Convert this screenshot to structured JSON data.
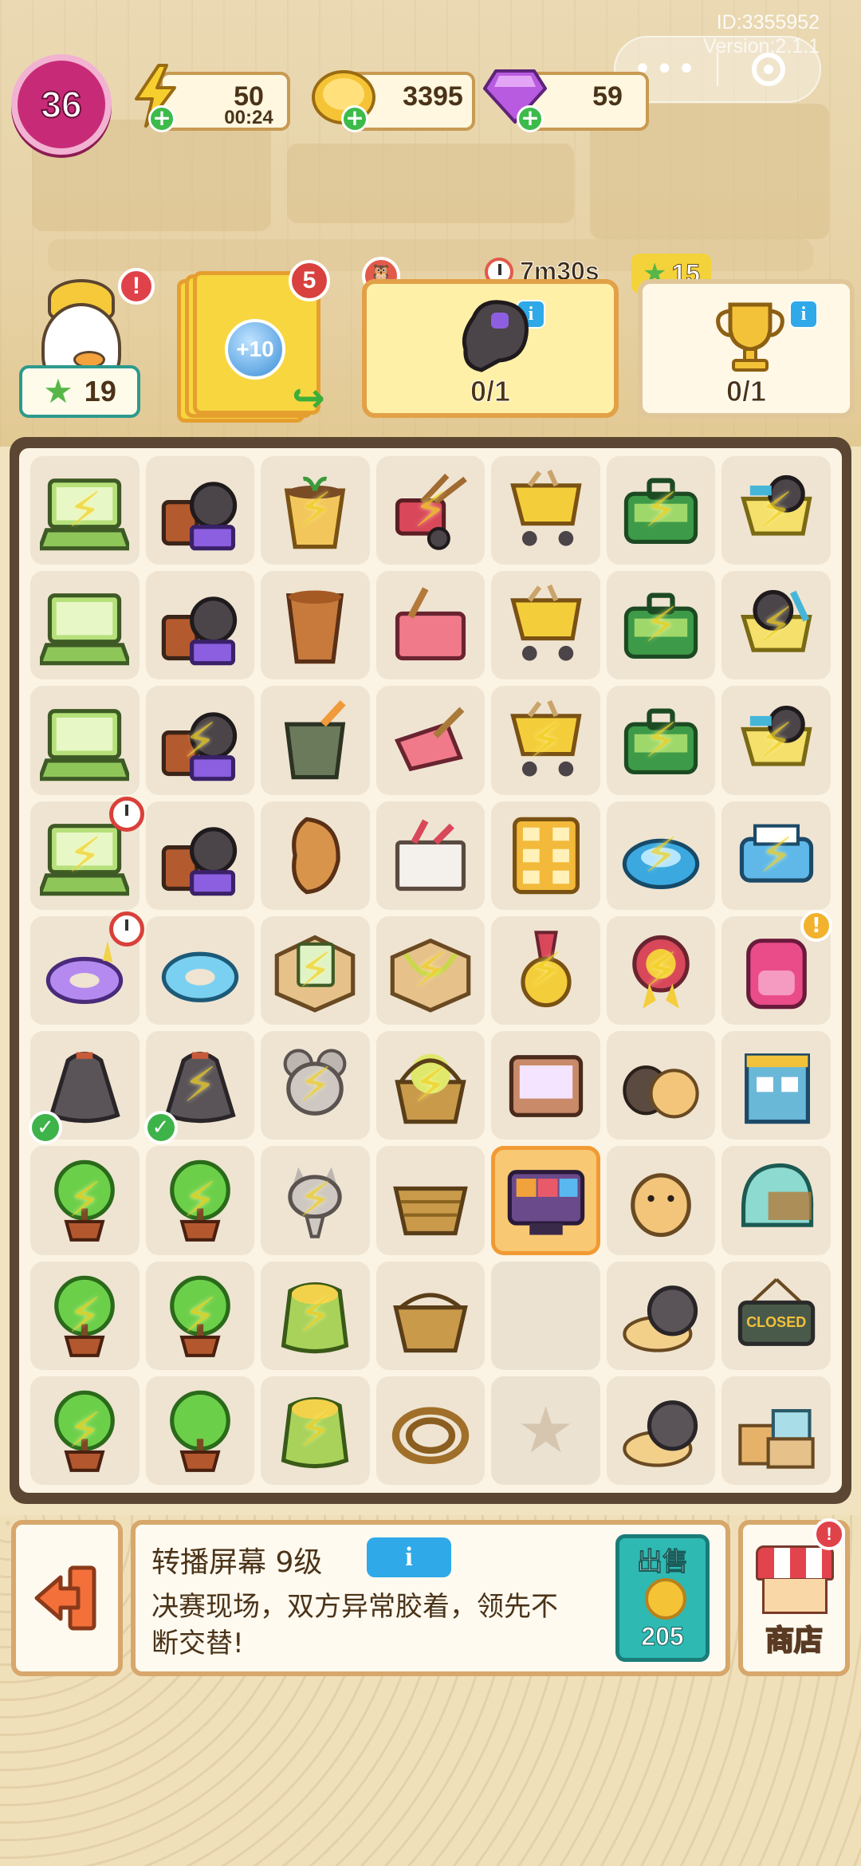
{
  "meta": {
    "id": "ID:3355952",
    "version": "Version:2.1.1"
  },
  "capsule": {
    "more_glyph": "•••",
    "close_icon": "target-circle"
  },
  "player": {
    "level": "36"
  },
  "resources": {
    "energy": {
      "value": "50",
      "timer": "00:24",
      "icon": "lightning-icon",
      "color": "#f6cf2e"
    },
    "coins": {
      "value": "3395",
      "icon": "coin-icon",
      "color": "#f5c336"
    },
    "gems": {
      "value": "59",
      "icon": "gem-icon",
      "color": "#b85be0"
    }
  },
  "goals": {
    "stars": "19",
    "card_stack": {
      "badge": "5",
      "bonus": "+10"
    },
    "task_timed": {
      "timer": "7m30s",
      "count": "0/1",
      "item": "boxing-glove"
    },
    "task_trophy": {
      "reward": "15",
      "count": "0/1",
      "item": "trophy"
    }
  },
  "board": {
    "rows": [
      [
        {
          "item": "laptop",
          "energy": true
        },
        {
          "item": "sports-gear-pile",
          "energy": false
        },
        {
          "item": "flower-pot-sprout",
          "energy": true
        },
        {
          "item": "garden-tools-cart",
          "energy": true
        },
        {
          "item": "shopping-cart-gold",
          "energy": false
        },
        {
          "item": "green-toolbox",
          "energy": true
        },
        {
          "item": "cart-helmet",
          "energy": true
        }
      ],
      [
        {
          "item": "laptop",
          "energy": false
        },
        {
          "item": "sports-gear-pile",
          "energy": false
        },
        {
          "item": "clay-pot",
          "energy": false
        },
        {
          "item": "pink-tray-shovel",
          "energy": false
        },
        {
          "item": "shopping-cart-gold",
          "energy": false
        },
        {
          "item": "green-toolbox",
          "energy": true
        },
        {
          "item": "cart-gear",
          "energy": true
        }
      ],
      [
        {
          "item": "laptop",
          "energy": false
        },
        {
          "item": "sports-gear-pile",
          "energy": true
        },
        {
          "item": "paint-bucket",
          "energy": false
        },
        {
          "item": "dustpan",
          "energy": false
        },
        {
          "item": "shopping-cart-gold",
          "energy": true
        },
        {
          "item": "green-toolbox",
          "energy": true
        },
        {
          "item": "cart-helmet",
          "energy": true
        }
      ],
      [
        {
          "item": "laptop",
          "energy": true,
          "clock": true
        },
        {
          "item": "sports-gear-pile",
          "energy": false
        },
        {
          "item": "clay-vase",
          "energy": false
        },
        {
          "item": "paint-box",
          "energy": false
        },
        {
          "item": "gold-cabinet",
          "energy": false
        },
        {
          "item": "robot-vacuum",
          "energy": true
        },
        {
          "item": "blue-printer",
          "energy": true
        }
      ],
      [
        {
          "item": "unicorn-float",
          "energy": false,
          "clock": true
        },
        {
          "item": "narwhal-float",
          "energy": false
        },
        {
          "item": "card-box-gt",
          "energy": true
        },
        {
          "item": "box-jumprope",
          "energy": true
        },
        {
          "item": "gold-medal",
          "energy": true
        },
        {
          "item": "rosette-award",
          "energy": true
        },
        {
          "item": "pink-backpack",
          "energy": false,
          "alert": true
        }
      ],
      [
        {
          "item": "trash-bag",
          "energy": false,
          "check": true
        },
        {
          "item": "trash-bag",
          "energy": true,
          "check": true
        },
        {
          "item": "mouse-statue",
          "energy": true
        },
        {
          "item": "flower-basket",
          "energy": true
        },
        {
          "item": "game-console",
          "energy": false
        },
        {
          "item": "hamster-pair",
          "energy": false
        },
        {
          "item": "shop-building",
          "energy": false
        }
      ],
      [
        {
          "item": "potted-tree",
          "energy": true
        },
        {
          "item": "potted-tree",
          "energy": true
        },
        {
          "item": "cat-statue",
          "energy": true
        },
        {
          "item": "woven-basket",
          "energy": false
        },
        {
          "item": "broadcast-screen",
          "energy": false,
          "selected": true
        },
        {
          "item": "hamster",
          "energy": false
        },
        {
          "item": "helmet",
          "energy": false
        }
      ],
      [
        {
          "item": "potted-tree",
          "energy": true
        },
        {
          "item": "potted-tree",
          "energy": true
        },
        {
          "item": "seed-sack",
          "energy": true
        },
        {
          "item": "basket-small",
          "energy": false
        },
        {
          "item": "empty",
          "energy": false
        },
        {
          "item": "snail-cat",
          "energy": false
        },
        {
          "item": "closed-sign",
          "energy": false,
          "text": "CLOSED"
        }
      ],
      [
        {
          "item": "potted-tree",
          "energy": true
        },
        {
          "item": "potted-tree",
          "energy": false
        },
        {
          "item": "seed-sack",
          "energy": true
        },
        {
          "item": "rope-coil",
          "energy": false
        },
        {
          "item": "locked-star",
          "energy": false
        },
        {
          "item": "snail-cat",
          "energy": false
        },
        {
          "item": "box-pile",
          "energy": false
        }
      ]
    ]
  },
  "selected_item": {
    "title": "转播屏幕 9级",
    "info_label": "i",
    "description": "决赛现场，双方异常胶着，领先不断交替!",
    "sell_label": "出售",
    "sell_price": "205"
  },
  "shop": {
    "label": "商店"
  },
  "exit": {
    "icon": "exit-icon"
  }
}
